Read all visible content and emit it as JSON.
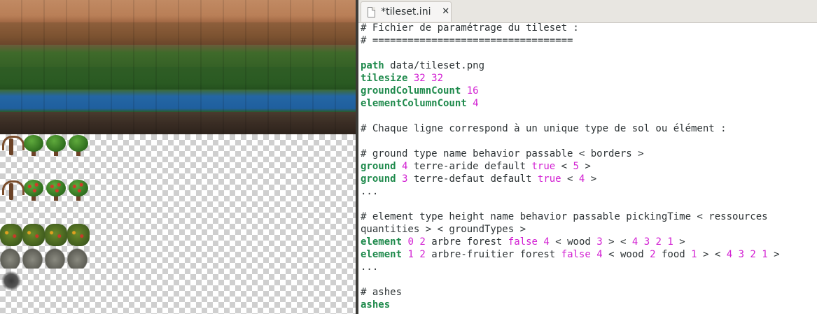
{
  "editor": {
    "tab_title": "*tileset.ini",
    "tab_icon": "document-icon",
    "close_icon": "close-icon",
    "lines": [
      [
        {
          "t": "# Fichier de paramétrage du tileset :",
          "s": "c"
        }
      ],
      [
        {
          "t": "# ==================================",
          "s": "c"
        }
      ],
      [],
      [
        {
          "t": "path",
          "s": "kw"
        },
        {
          "t": " data/tileset.png",
          "s": "p"
        }
      ],
      [
        {
          "t": "tilesize",
          "s": "kw"
        },
        {
          "t": " ",
          "s": "p"
        },
        {
          "t": "32",
          "s": "num"
        },
        {
          "t": " ",
          "s": "p"
        },
        {
          "t": "32",
          "s": "num"
        }
      ],
      [
        {
          "t": "groundColumnCount",
          "s": "kw"
        },
        {
          "t": " ",
          "s": "p"
        },
        {
          "t": "16",
          "s": "num"
        }
      ],
      [
        {
          "t": "elementColumnCount",
          "s": "kw"
        },
        {
          "t": " ",
          "s": "p"
        },
        {
          "t": "4",
          "s": "num"
        }
      ],
      [],
      [
        {
          "t": "# Chaque ligne correspond à un unique type de sol ou élément :",
          "s": "c"
        }
      ],
      [],
      [
        {
          "t": "# ground type name behavior passable < borders >",
          "s": "c"
        }
      ],
      [
        {
          "t": "ground",
          "s": "kw"
        },
        {
          "t": " ",
          "s": "p"
        },
        {
          "t": "4",
          "s": "num"
        },
        {
          "t": " terre-aride default ",
          "s": "p"
        },
        {
          "t": "true",
          "s": "num"
        },
        {
          "t": " < ",
          "s": "p"
        },
        {
          "t": "5",
          "s": "num"
        },
        {
          "t": " >",
          "s": "p"
        }
      ],
      [
        {
          "t": "ground",
          "s": "kw"
        },
        {
          "t": " ",
          "s": "p"
        },
        {
          "t": "3",
          "s": "num"
        },
        {
          "t": " terre-defaut default ",
          "s": "p"
        },
        {
          "t": "true",
          "s": "num"
        },
        {
          "t": " < ",
          "s": "p"
        },
        {
          "t": "4",
          "s": "num"
        },
        {
          "t": " >",
          "s": "p"
        }
      ],
      [
        {
          "t": "...",
          "s": "p"
        }
      ],
      [],
      [
        {
          "t": "# element type height name behavior passable pickingTime < ressources",
          "s": "c"
        }
      ],
      [
        {
          "t": "quantities > < groundTypes >",
          "s": "c"
        }
      ],
      [
        {
          "t": "element",
          "s": "kw"
        },
        {
          "t": " ",
          "s": "p"
        },
        {
          "t": "0",
          "s": "num"
        },
        {
          "t": " ",
          "s": "p"
        },
        {
          "t": "2",
          "s": "num"
        },
        {
          "t": " arbre forest ",
          "s": "p"
        },
        {
          "t": "false",
          "s": "num"
        },
        {
          "t": " ",
          "s": "p"
        },
        {
          "t": "4",
          "s": "num"
        },
        {
          "t": " < wood ",
          "s": "p"
        },
        {
          "t": "3",
          "s": "num"
        },
        {
          "t": " > < ",
          "s": "p"
        },
        {
          "t": "4 3 2 1",
          "s": "num"
        },
        {
          "t": " >",
          "s": "p"
        }
      ],
      [
        {
          "t": "element",
          "s": "kw"
        },
        {
          "t": " ",
          "s": "p"
        },
        {
          "t": "1",
          "s": "num"
        },
        {
          "t": " ",
          "s": "p"
        },
        {
          "t": "2",
          "s": "num"
        },
        {
          "t": " arbre-fruitier forest ",
          "s": "p"
        },
        {
          "t": "false",
          "s": "num"
        },
        {
          "t": " ",
          "s": "p"
        },
        {
          "t": "4",
          "s": "num"
        },
        {
          "t": " < wood ",
          "s": "p"
        },
        {
          "t": "2",
          "s": "num"
        },
        {
          "t": " food ",
          "s": "p"
        },
        {
          "t": "1",
          "s": "num"
        },
        {
          "t": " > < ",
          "s": "p"
        },
        {
          "t": "4 3 2 1",
          "s": "num"
        },
        {
          "t": " >",
          "s": "p"
        }
      ],
      [
        {
          "t": "...",
          "s": "p"
        }
      ],
      [],
      [
        {
          "t": "# ashes",
          "s": "c"
        }
      ],
      [
        {
          "t": "ashes",
          "s": "kw"
        }
      ]
    ]
  },
  "colors": {
    "keyword": "#1f8a4c",
    "number": "#d21fd2",
    "text": "#2e3436",
    "divider": "#3c3b37"
  }
}
